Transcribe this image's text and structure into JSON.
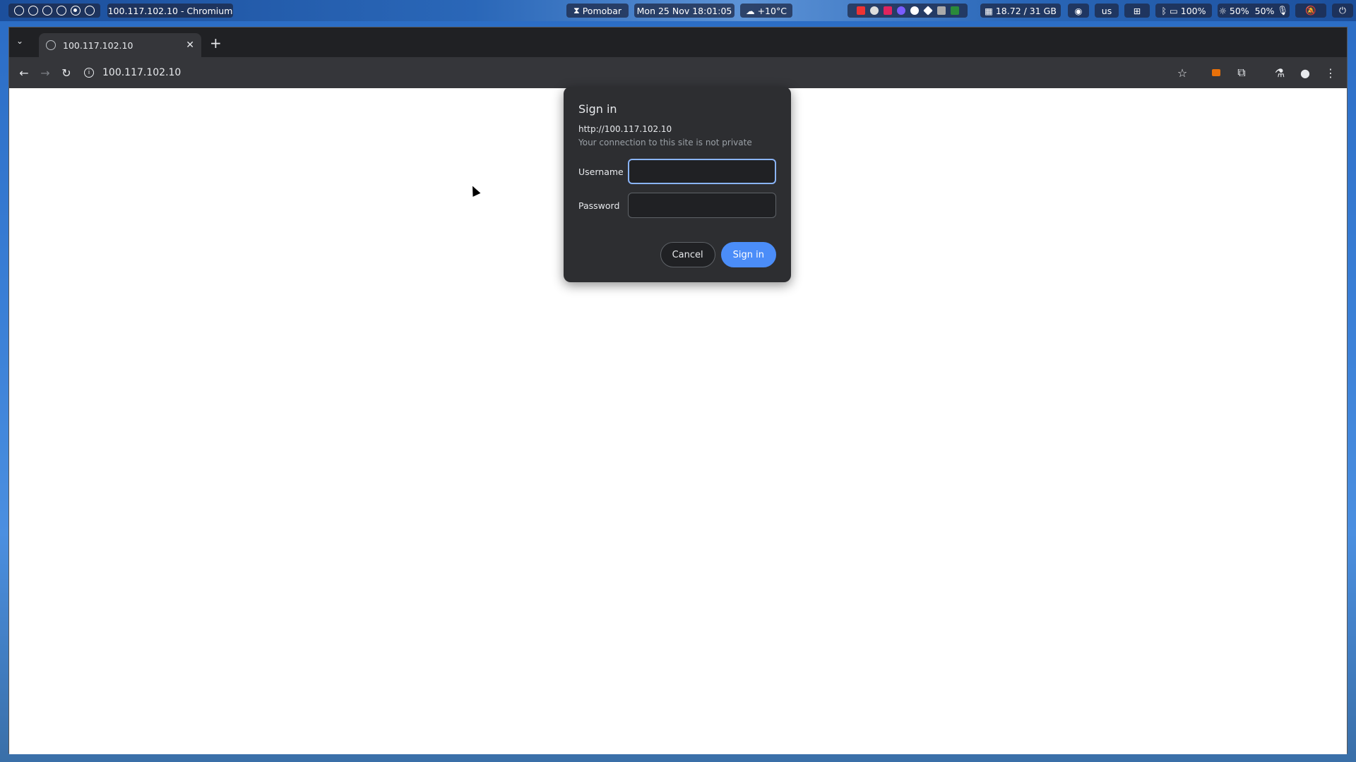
{
  "panel": {
    "window_title": "100.117.102.10 - Chromium",
    "pomobar": "Pomobar",
    "datetime": "Mon 25 Nov  18:01:05",
    "weather": "+10°C",
    "memory": "18.72 / 31 GB",
    "keyboard": "us",
    "battery": "100%",
    "brightness": "50%",
    "mic": "50%"
  },
  "browser": {
    "tab_title": "100.117.102.10",
    "address": "100.117.102.10"
  },
  "dialog": {
    "title": "Sign in",
    "origin": "http://100.117.102.10",
    "warning": "Your connection to this site is not private",
    "username_label": "Username",
    "username_value": "",
    "password_label": "Password",
    "password_value": "",
    "cancel_label": "Cancel",
    "signin_label": "Sign in"
  },
  "colors": {
    "accent": "#4b8df8",
    "dialog_bg": "#2d2e31",
    "toolbar_bg": "#35363a"
  }
}
